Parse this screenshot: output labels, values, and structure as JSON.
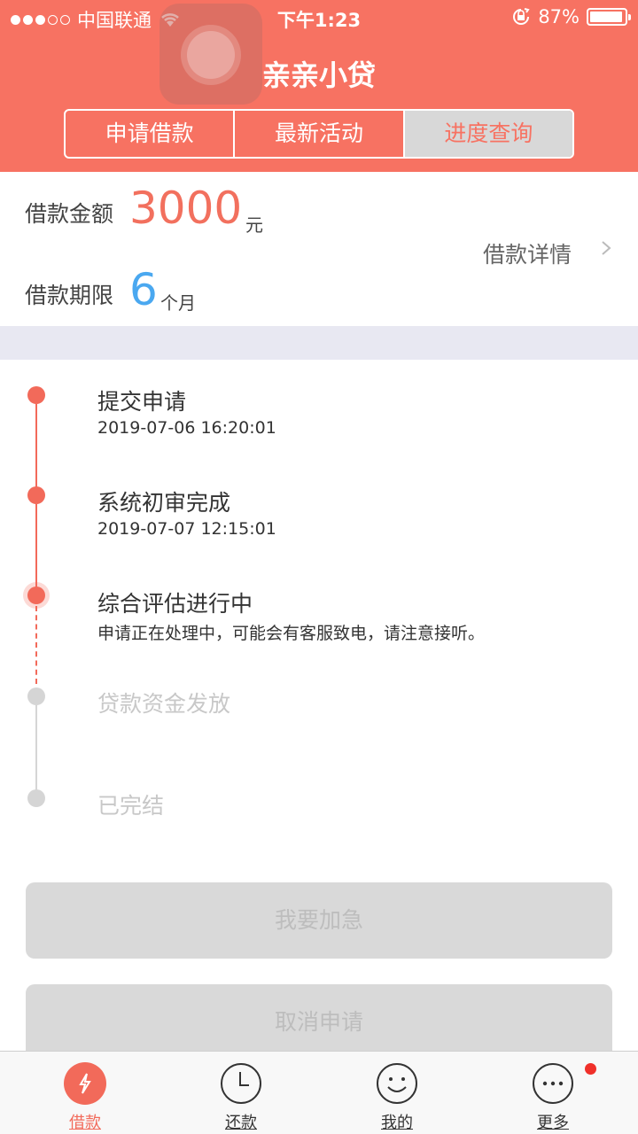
{
  "status_bar": {
    "carrier": "中国联通",
    "time": "下午1:23",
    "battery_percent": "87%",
    "battery_level": 0.87
  },
  "header": {
    "title": "亲亲小贷",
    "tabs": [
      {
        "label": "申请借款",
        "active": false
      },
      {
        "label": "最新活动",
        "active": false
      },
      {
        "label": "进度查询",
        "active": true
      }
    ]
  },
  "summary": {
    "amount_label": "借款金额",
    "amount_value": "3000",
    "amount_unit": "元",
    "term_label": "借款期限",
    "term_value": "6",
    "term_unit": "个月",
    "detail_link": "借款详情"
  },
  "timeline": {
    "steps": [
      {
        "title": "提交申请",
        "subtitle": "2019-07-06 16:20:01",
        "state": "done"
      },
      {
        "title": "系统初审完成",
        "subtitle": "2019-07-07 12:15:01",
        "state": "done"
      },
      {
        "title": "综合评估进行中",
        "subtitle": "申请正在处理中，可能会有客服致电，请注意接听。",
        "state": "current"
      },
      {
        "title": "贷款资金发放",
        "subtitle": "",
        "state": "pending"
      },
      {
        "title": "已完结",
        "subtitle": "",
        "state": "pending"
      }
    ]
  },
  "actions": {
    "urgent_label": "我要加急",
    "cancel_label": "取消申请"
  },
  "tabbar": {
    "items": [
      {
        "label": "借款",
        "icon": "lightning-icon",
        "active": true
      },
      {
        "label": "还款",
        "icon": "clock-icon",
        "active": false
      },
      {
        "label": "我的",
        "icon": "smiley-icon",
        "active": false
      },
      {
        "label": "更多",
        "icon": "more-icon",
        "active": false,
        "badge": true
      }
    ]
  },
  "colors": {
    "brand": "#f77262",
    "accent_red": "#f26a5a",
    "accent_blue": "#4aa8f0",
    "pending_grey": "#d5d5d5",
    "band": "#e8e8f2"
  }
}
